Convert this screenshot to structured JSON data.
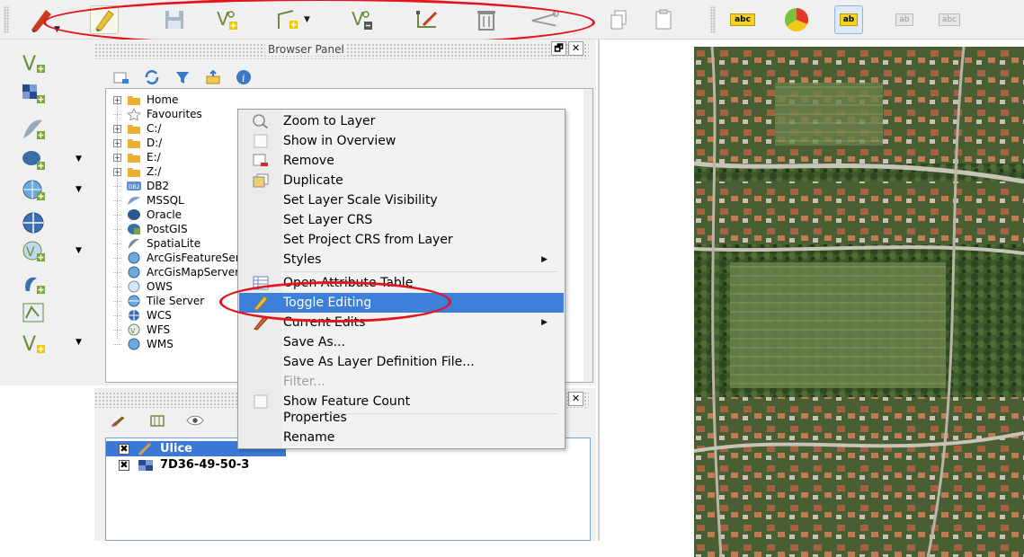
{
  "browser_panel": {
    "title": "Browser Panel",
    "tree": [
      {
        "label": "Home",
        "icon": "folder-icon",
        "expandable": true
      },
      {
        "label": "Favourites",
        "icon": "star-icon",
        "expandable": false
      },
      {
        "label": "C:/",
        "icon": "folder-icon",
        "expandable": true
      },
      {
        "label": "D:/",
        "icon": "folder-icon",
        "expandable": true
      },
      {
        "label": "E:/",
        "icon": "folder-icon",
        "expandable": true
      },
      {
        "label": "Z:/",
        "icon": "folder-icon",
        "expandable": true
      },
      {
        "label": "DB2",
        "icon": "db2-icon",
        "expandable": false
      },
      {
        "label": "MSSQL",
        "icon": "mssql-icon",
        "expandable": false
      },
      {
        "label": "Oracle",
        "icon": "oracle-icon",
        "expandable": false
      },
      {
        "label": "PostGIS",
        "icon": "postgis-icon",
        "expandable": false
      },
      {
        "label": "SpatiaLite",
        "icon": "spatialite-icon",
        "expandable": false
      },
      {
        "label": "ArcGisFeatureServer",
        "icon": "arcgis-icon",
        "expandable": false
      },
      {
        "label": "ArcGisMapServer",
        "icon": "arcgis-icon",
        "expandable": false
      },
      {
        "label": "OWS",
        "icon": "ows-icon",
        "expandable": false
      },
      {
        "label": "Tile Server",
        "icon": "tile-server-icon",
        "expandable": false
      },
      {
        "label": "WCS",
        "icon": "wcs-icon",
        "expandable": false
      },
      {
        "label": "WFS",
        "icon": "wfs-icon",
        "expandable": false
      },
      {
        "label": "WMS",
        "icon": "wms-icon",
        "expandable": false
      }
    ]
  },
  "layers_panel": {
    "layers": [
      {
        "name": "Ulice",
        "checked": "✖",
        "icon": "line-layer-icon",
        "selected": true
      },
      {
        "name": "7D36-49-50-3",
        "checked": "✖",
        "icon": "raster-layer-icon",
        "selected": false
      }
    ]
  },
  "context_menu": {
    "items": [
      {
        "label": "Zoom to Layer",
        "icon": "zoom-layer-icon"
      },
      {
        "label": "Show in Overview",
        "icon": "checkbox-icon"
      },
      {
        "label": "Remove",
        "icon": "remove-layer-icon"
      },
      {
        "label": "Duplicate",
        "icon": "duplicate-icon"
      },
      {
        "label": "Set Layer Scale Visibility",
        "icon": ""
      },
      {
        "label": "Set Layer CRS",
        "icon": ""
      },
      {
        "label": "Set Project CRS from Layer",
        "icon": ""
      },
      {
        "label": "Styles",
        "icon": "",
        "submenu": "▶"
      },
      {
        "label": "Open Attribute Table",
        "icon": "attribute-table-icon"
      },
      {
        "label": "Toggle Editing",
        "icon": "pencil-icon",
        "highlighted": true
      },
      {
        "label": "Current Edits",
        "icon": "pencil-icon",
        "submenu": "▶"
      },
      {
        "label": "Save As...",
        "icon": ""
      },
      {
        "label": "Save As Layer Definition File...",
        "icon": ""
      },
      {
        "label": "Filter...",
        "icon": "",
        "disabled": true
      },
      {
        "label": "Show Feature Count",
        "icon": "checkbox-icon"
      },
      {
        "label": "Properties",
        "icon": ""
      },
      {
        "label": "Rename",
        "icon": ""
      }
    ]
  },
  "toolbar": {
    "label_tool_text": "abc",
    "label_tool_active_text": "ab",
    "label_tool_faded_text": "ab",
    "label_tool_faded2_text": "abc"
  },
  "colors": {
    "highlight": "#3d7fd9",
    "annotation": "#e3141c",
    "selected_row": "#3b79d8"
  }
}
